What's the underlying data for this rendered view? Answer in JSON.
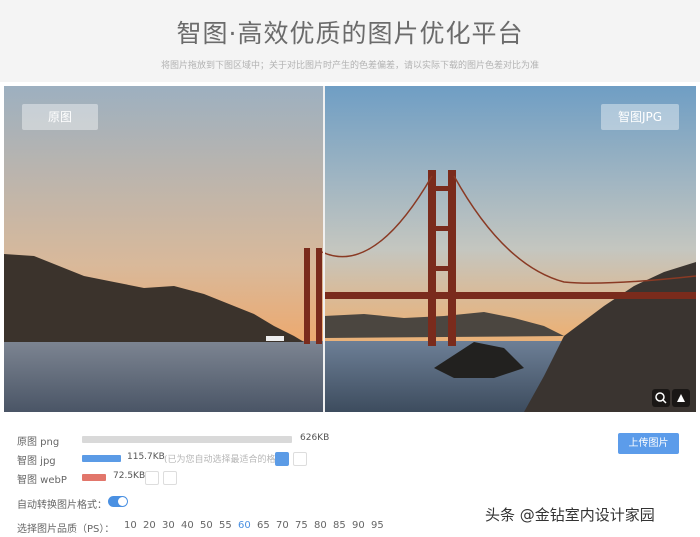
{
  "header": {
    "title": "智图·高效优质的图片优化平台",
    "subtitle": "将图片拖放到下图区域中；关于对比图片时产生的色差偏差，请以实际下载的图片色差对比为准"
  },
  "compare": {
    "original_label": "原图",
    "optimized_label": "智图JPG"
  },
  "files": [
    {
      "label": "原图 png",
      "size": "626KB",
      "ratio": 1.0,
      "color": "#d9d9d9"
    },
    {
      "label": "智图 jpg",
      "size": "115.7KB",
      "ratio": 0.185,
      "color": "#5b9be6",
      "note": "(已为您自动选择最适合的格式)"
    },
    {
      "label": "智图 webP",
      "size": "72.5KB",
      "ratio": 0.116,
      "color": "#e2766b"
    }
  ],
  "upload_label": "上传图片",
  "auto_convert_label": "自动转换图片格式：",
  "quality": {
    "label": "选择图片品质（PS）：",
    "options": [
      "10",
      "20",
      "30",
      "40",
      "50",
      "55",
      "60",
      "65",
      "70",
      "75",
      "80",
      "85",
      "90",
      "95"
    ],
    "selected": "60"
  },
  "watermark": "头条 @金钻室内设计家园",
  "icons": {
    "zoom": "zoom-icon",
    "tools": "tools-icon",
    "eye": "eye-icon",
    "download": "download-icon"
  }
}
